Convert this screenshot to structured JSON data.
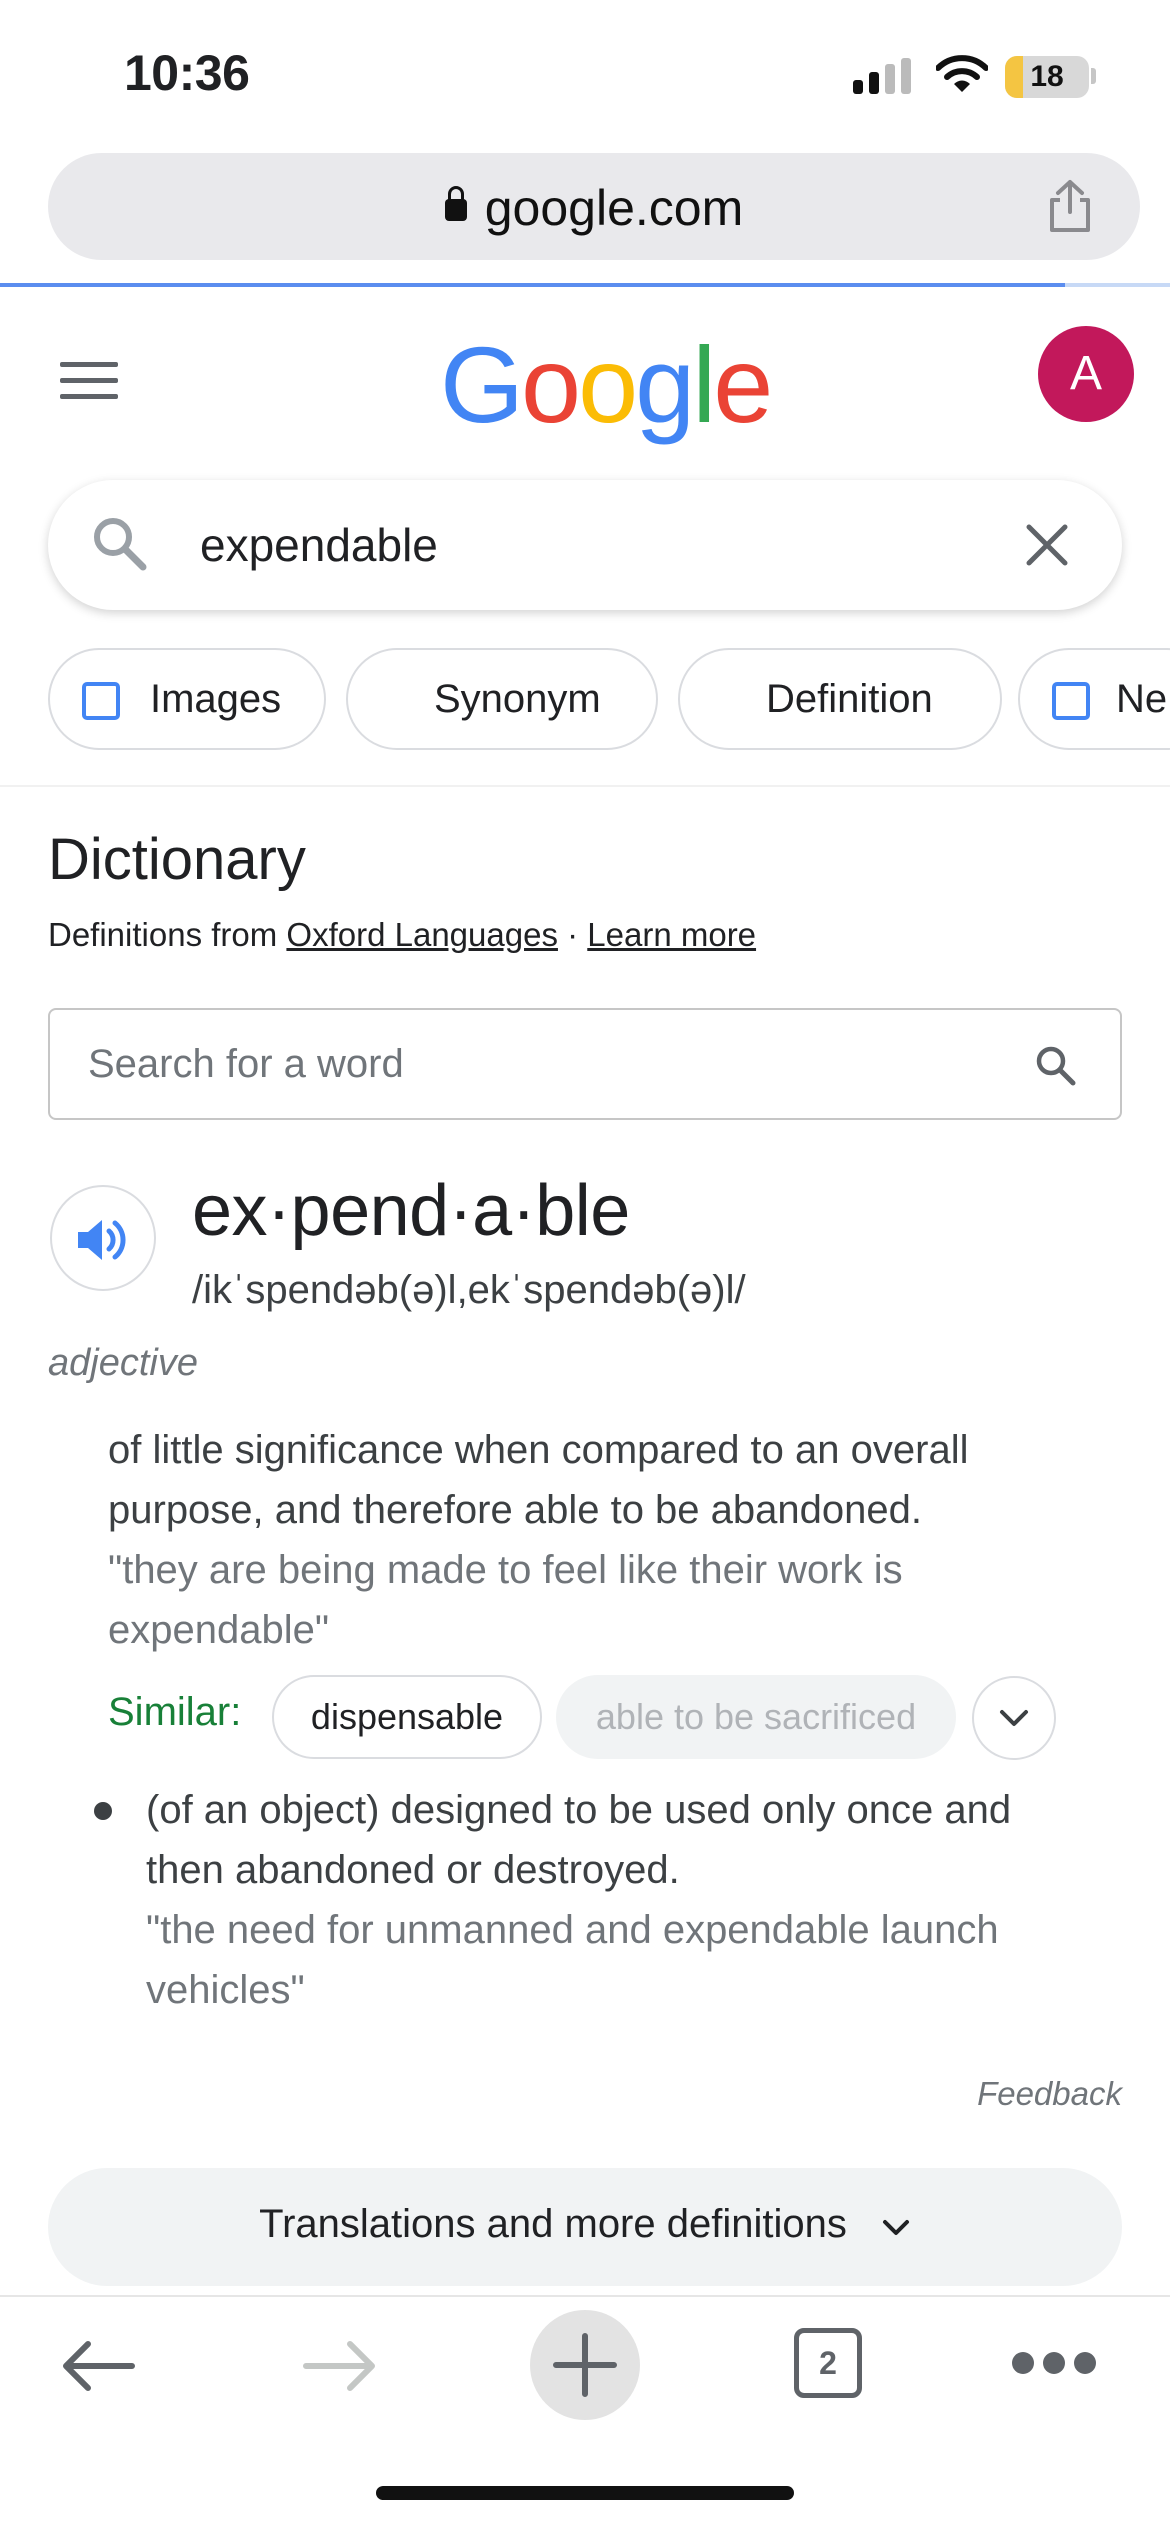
{
  "status_bar": {
    "time": "10:36",
    "battery": "18"
  },
  "browser": {
    "url": "google.com",
    "load_progress": 0.91
  },
  "header": {
    "logo_text": "Google",
    "avatar_letter": "A"
  },
  "search": {
    "query": "expendable"
  },
  "chips": [
    {
      "label": "Images",
      "icon": "image-icon"
    },
    {
      "label": "Synonym"
    },
    {
      "label": "Definition"
    },
    {
      "label": "Ne",
      "icon": "news-icon"
    }
  ],
  "dictionary": {
    "title": "Dictionary",
    "source_prefix": "Definitions from ",
    "source_link": "Oxford Languages",
    "separator": " · ",
    "learn_more": "Learn more",
    "search_placeholder": "Search for a word",
    "headword": "ex·pend·a·ble",
    "pronunciation": "/ikˈspendəb(ə)l,ekˈspendəb(ə)l/",
    "part_of_speech": "adjective",
    "sense1": {
      "definition": "of little significance when compared to an overall purpose, and therefore able to be abandoned.",
      "example": "\"they are being made to feel like their work is expendable\""
    },
    "similar_label": "Similar:",
    "similar": [
      "dispensable",
      "able to be sacrificed"
    ],
    "sense2": {
      "definition": "(of an object) designed to be used only once and then abandoned or destroyed.",
      "example": "\"the need for unmanned and expendable launch vehicles\""
    },
    "feedback": "Feedback",
    "more_button": "Translations and more definitions"
  },
  "toolbar": {
    "tab_count": "2"
  },
  "colors": {
    "avatar": "#c2185b",
    "similar_label": "#188038",
    "accent_blue": "#4285f4"
  }
}
